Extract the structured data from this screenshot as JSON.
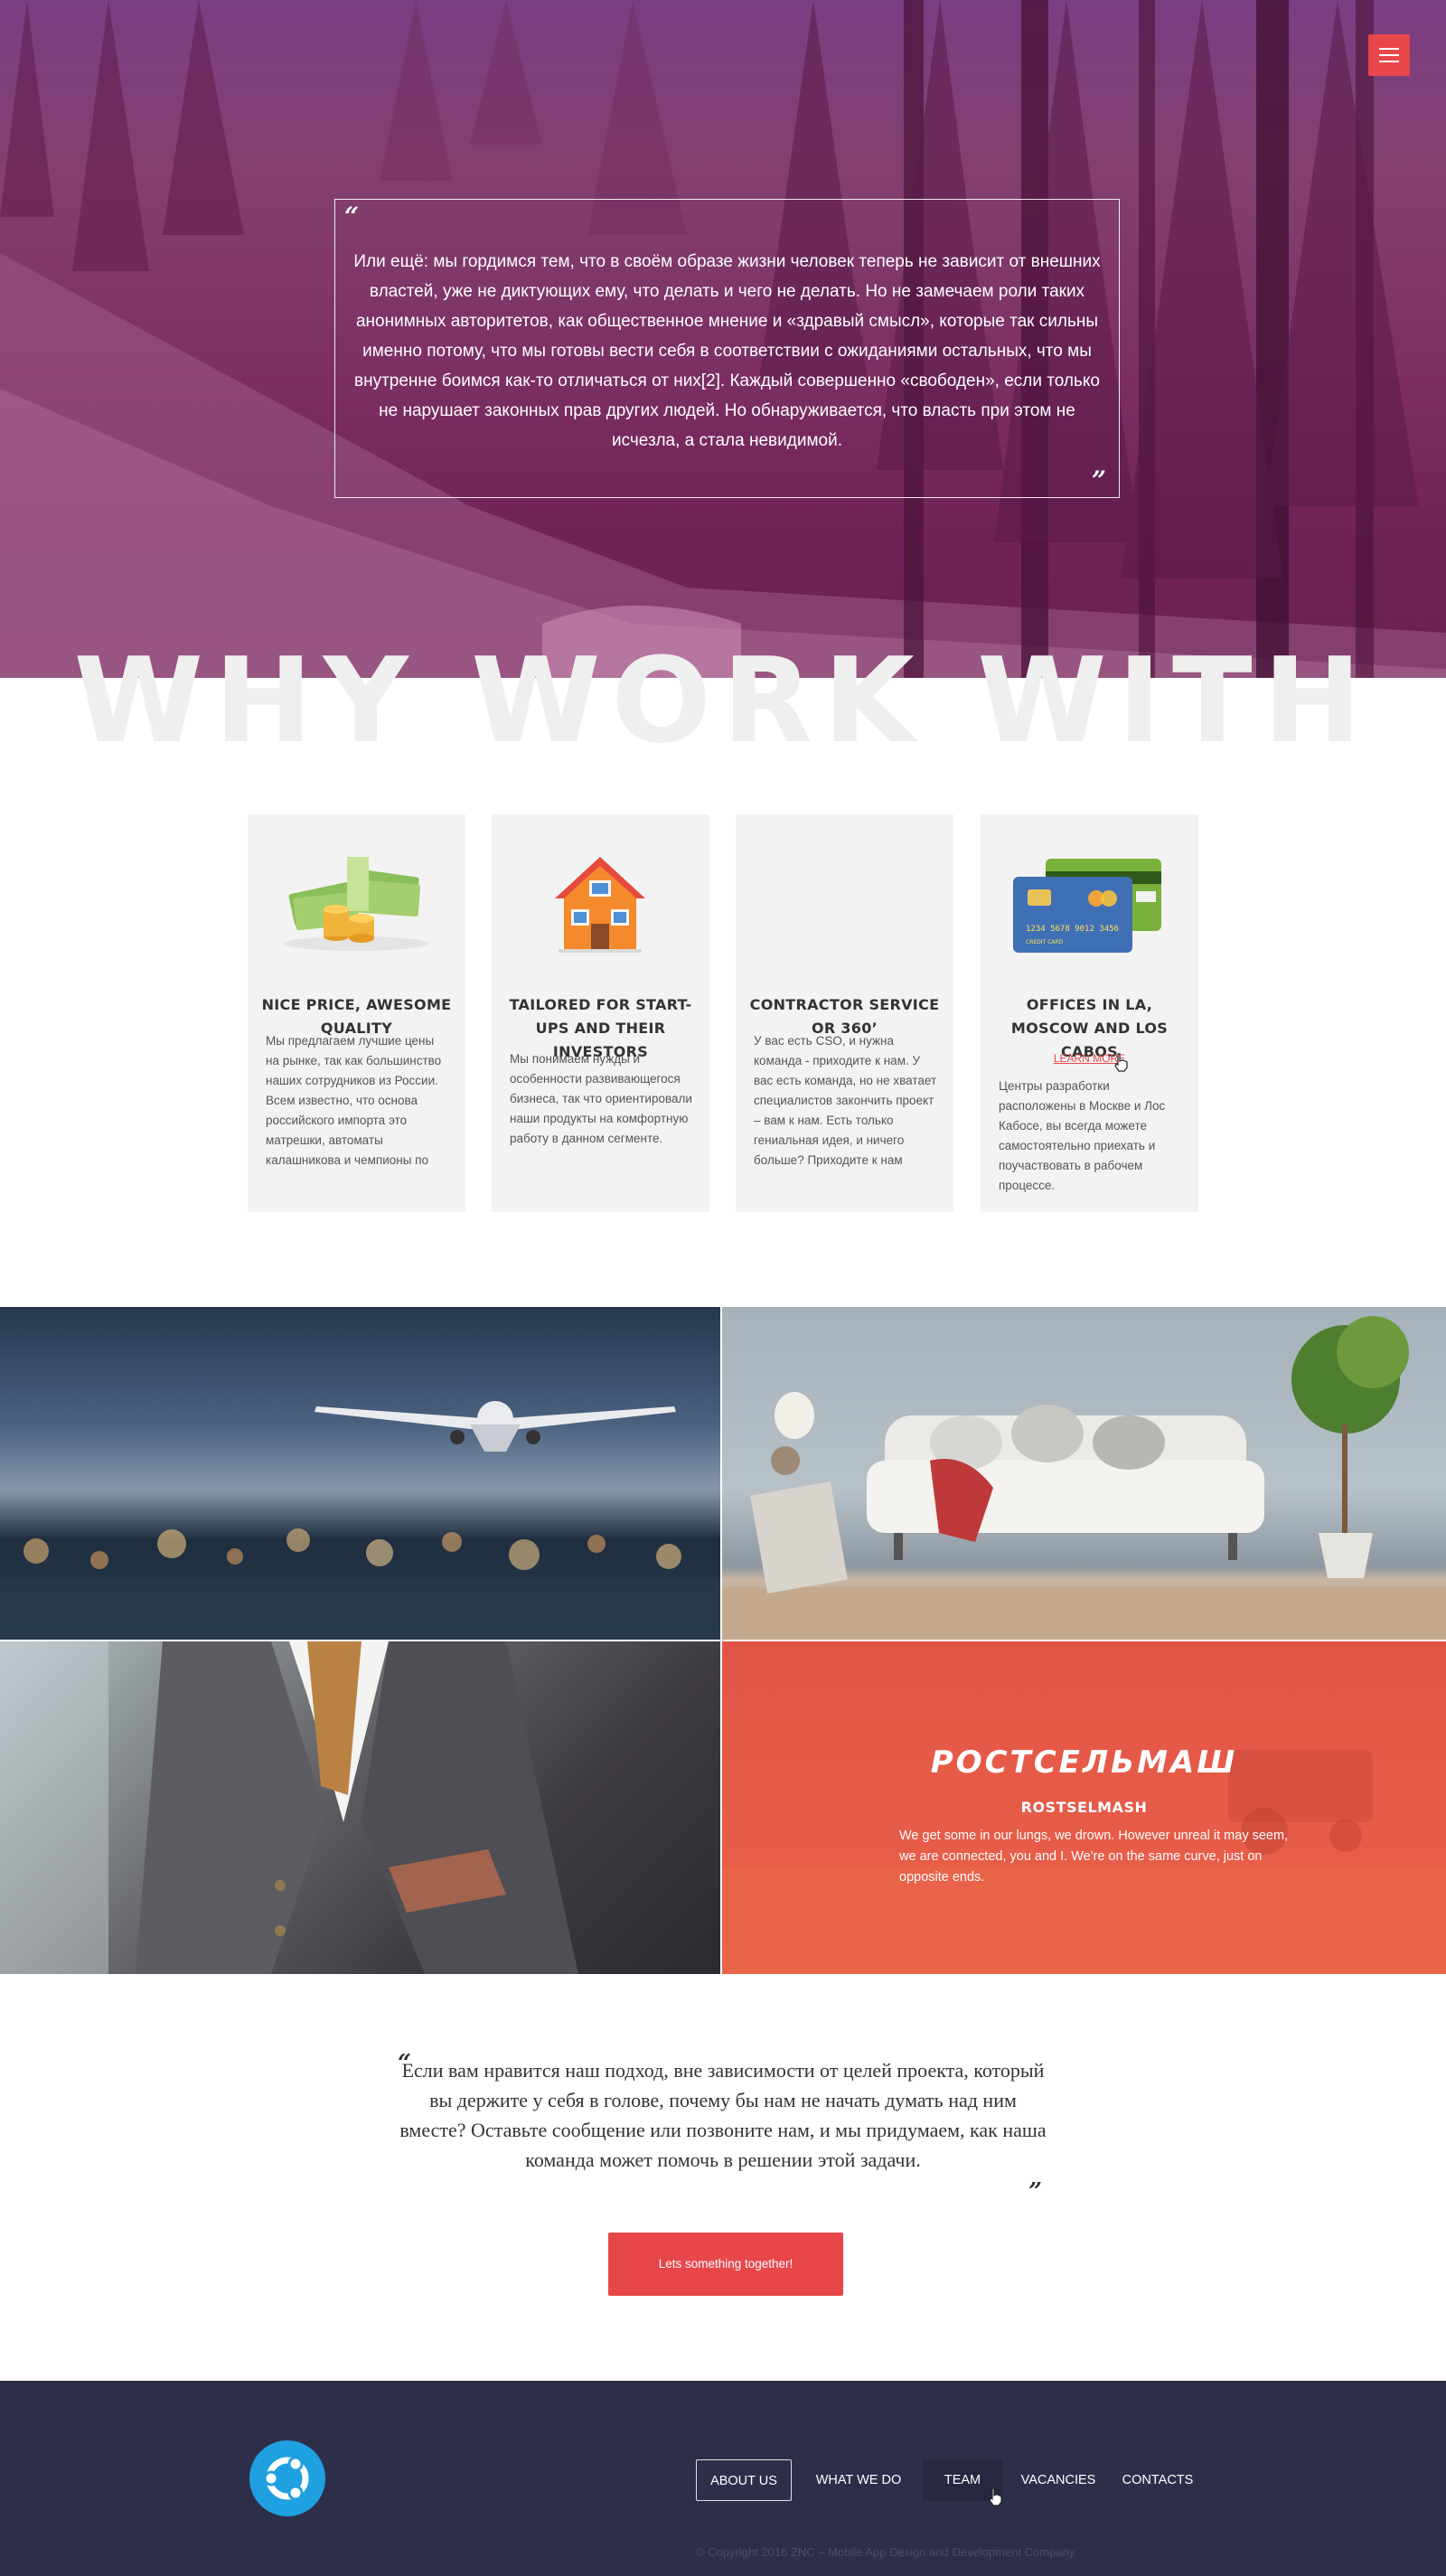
{
  "hero": {
    "quote": "Или ещё: мы гордимся тем, что в своём образе жизни человек теперь не зависит от внешних властей, уже не диктующих ему, что делать и чего не делать. Но не замечаем роли таких анонимных авторитетов, как общественное мнение и «здравый смысл», которые так сильны именно потому, что мы готовы вести себя в соответствии с ожиданиями остальных, что мы внутренне боимся как-то отличаться от них[2]. Каждый совершенно «свободен», если только не нарушает законных прав других людей. Но обнаруживается, что власть при этом не исчезла, а стала невидимой.",
    "quote_open": "“",
    "quote_close": "”",
    "menu_icon": "hamburger-icon"
  },
  "why": {
    "title": "WHY WORK WITH US",
    "cards": [
      {
        "title": "NICE PRICE, AWESOME QUALITY",
        "text": "Мы предлагаем лучшие цены на рынке, так как большинство наших сотрудников из России. Всем известно, что основа российского импорта это матрешки, автоматы калашникова и чемпионы по",
        "icon": "money-icon"
      },
      {
        "title": "TAILORED FOR START-UPS AND THEIR INVESTORS",
        "text": "Мы понимаем нужды и особенности развивающегося бизнеса, так что ориентировали наши продукты на комфортную работу в данном сегменте.",
        "icon": "house-icon"
      },
      {
        "title": "CONTRACTOR SERVICE OR 360’",
        "text": "У вас есть CSO, и нужна команда - приходите к нам. У вас есть команда, но не хватает специалистов закончить проект – вам к нам. Есть только гениальная идея, и ничего больше? Приходите к нам",
        "icon": ""
      },
      {
        "title": "OFFICES IN LA, MOSCOW AND LOS CABOS",
        "link": "LEARN MORE",
        "text": "Центры разработки расположены в Москве и Лос Кабосе, вы всегда можете самостоятельно приехать и поучаствовать в рабочем процессе.",
        "icon": "credit-card-icon",
        "card_number": "1234 5678 9012 3456",
        "card_label": "CREDIT CARD"
      }
    ]
  },
  "gallery": {
    "brand_logo": "РОСТСЕЛЬМАШ",
    "brand_name": "ROSTSELMASH",
    "brand_text": "We get some in our lungs, we drown. However unreal it may seem, we are connected, you and I. We're on the same curve, just on opposite ends."
  },
  "cta": {
    "quote": "Если вам нравится наш подход, вне зависимости от целей проекта, который вы держите у себя в голове, почему бы нам не начать думать над ним вместе? Оставьте сообщение или позвоните нам, и мы придумаем, как наша команда может помочь в решении этой задачи.",
    "quote_open": "“",
    "quote_close": "”",
    "button": "Lets something together!"
  },
  "footer": {
    "logo_icon": "ubuntu-logo-icon",
    "nav": [
      "ABOUT US",
      "WHAT WE DO",
      "TEAM",
      "VACANCIES",
      "CONTACTS"
    ],
    "copyright": "© Copyright 2016 ZNC – Mobile App Design and Development Company."
  },
  "colors": {
    "accent": "#e8474a",
    "footer_bg": "#2d2f4a",
    "hero_tint": "#7c2f63"
  }
}
